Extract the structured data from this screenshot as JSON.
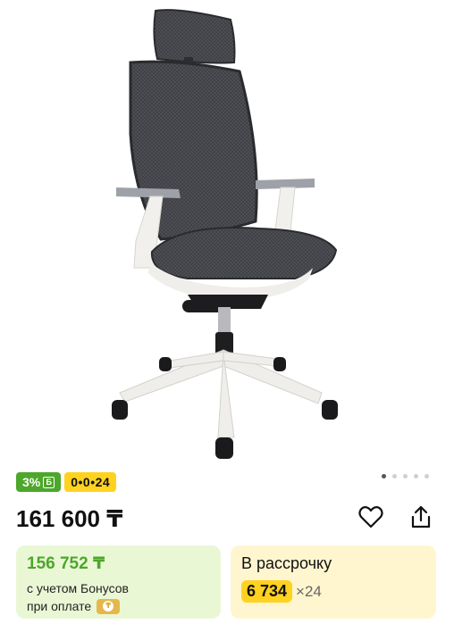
{
  "product": {
    "image_alt": "office-chair-photo"
  },
  "gallery": {
    "total_slides": 5,
    "active_index": 0
  },
  "badges": {
    "bonus_percent": "3%",
    "bonus_currency": "Б",
    "installment": "0•0•24"
  },
  "price": {
    "main": "161 600 ₸"
  },
  "icons": {
    "favorite": "heart-icon",
    "share": "share-icon"
  },
  "bonus_card": {
    "price": "156 752 ₸",
    "line1": "с учетом Бонусов",
    "line2": "при оплате"
  },
  "credit_card": {
    "title": "В рассрочку",
    "monthly": "6 734",
    "times": "×24"
  },
  "colors": {
    "bonus_green": "#4ca72a",
    "installment_yellow": "#ffd21f",
    "bonus_card_bg": "#eaf7d5",
    "credit_card_bg": "#fff6cf"
  }
}
